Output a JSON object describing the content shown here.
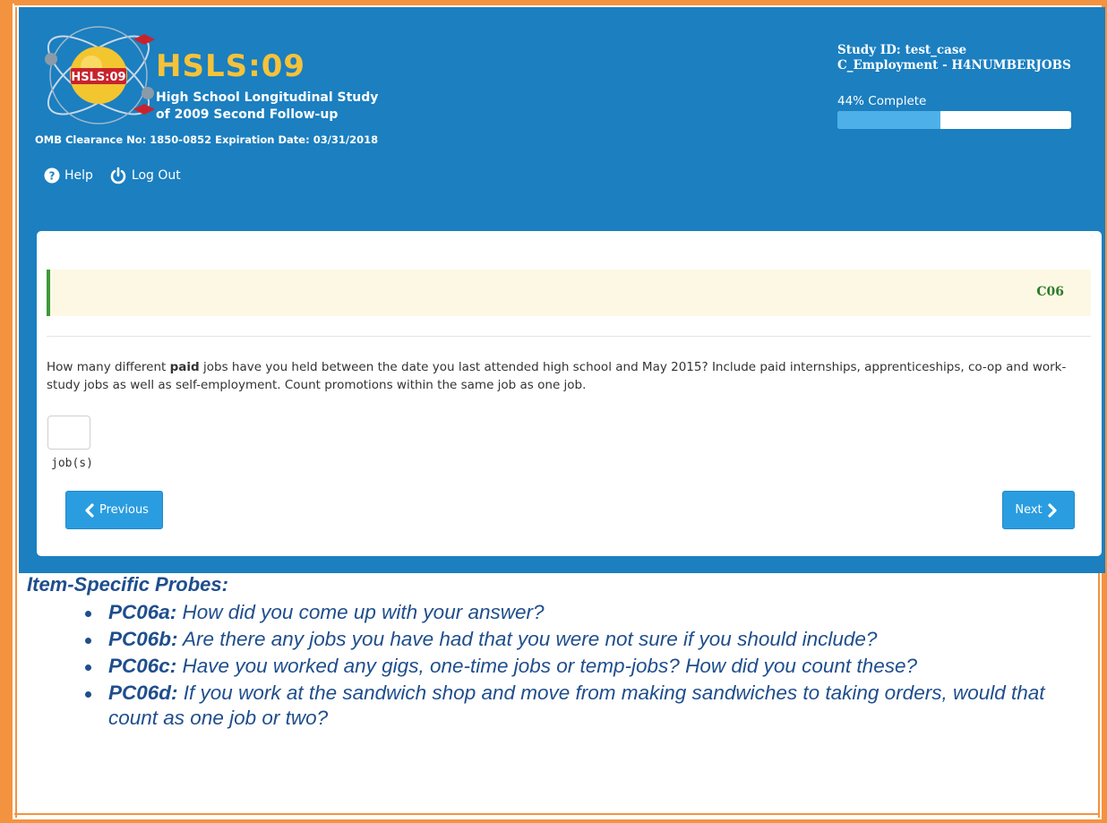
{
  "brand": {
    "title": "HSLS:09",
    "subtitle_line1": "High School Longitudinal Study",
    "subtitle_line2": "of 2009 Second Follow-up",
    "omb": "OMB Clearance No: 1850-0852 Expiration Date: 03/31/2018",
    "seal_text": "HSLS:09"
  },
  "study": {
    "id_line": "Study ID: test_case",
    "section_line": "C_Employment - H4NUMBERJOBS",
    "progress_label": "44% Complete",
    "progress_percent": 44
  },
  "nav": {
    "help": "Help",
    "logout": "Log Out"
  },
  "question": {
    "code": "C06",
    "text_before": "How many different ",
    "text_bold": "paid",
    "text_after": " jobs have you held between the date you last attended high school and May 2015? Include paid internships, apprenticeships, co-op and work-study jobs as well as self-employment. Count promotions within the same job as one job.",
    "answer_value": "",
    "unit": "job(s)"
  },
  "buttons": {
    "previous": "Previous",
    "next": "Next"
  },
  "probes": {
    "title": "Item-Specific Probes:",
    "items": [
      {
        "code": "PC06a:",
        "text": " How did you come up with your answer?"
      },
      {
        "code": "PC06b:",
        "text": " Are there any jobs you have had that you were not sure if you should include?"
      },
      {
        "code": "PC06c:",
        "text": " Have you worked any gigs, one-time jobs or temp-jobs? How did you count these?"
      },
      {
        "code": "PC06d:",
        "text": " If you work at the sandwich shop and move from making sandwiches to taking orders, would that count as one job or two?"
      }
    ]
  },
  "colors": {
    "banner": "#1b7fc0",
    "frame": "#f4933f",
    "button": "#2a9de0",
    "probe_text": "#1f4e8c",
    "question_code": "#2d7d29"
  }
}
